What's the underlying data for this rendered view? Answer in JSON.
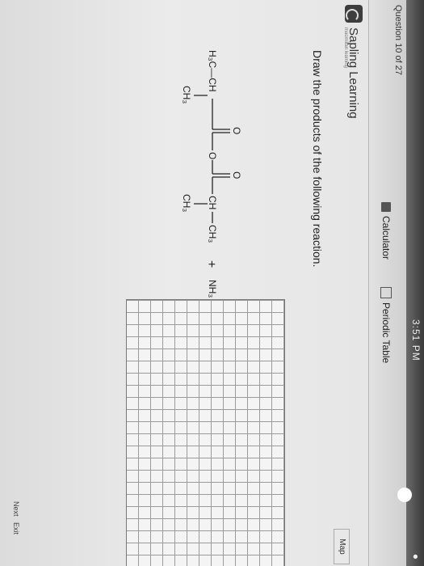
{
  "status_bar": {
    "clock": "3:51 PM"
  },
  "toolbar": {
    "question_counter": "Question 10 of 27",
    "calculator_label": "Calculator",
    "periodic_table_label": "Periodic Table"
  },
  "brand": {
    "name": "Sapling Learning",
    "tagline": "macmillan learning"
  },
  "map_button": "Map",
  "question": {
    "prompt": "Draw the products of the following reaction.",
    "reactant": {
      "left_group": "H₃C—CH",
      "left_methyl": "CH₃",
      "carbonyl_o1": "O",
      "ester_o": "O",
      "carbonyl_o2": "O",
      "right_ch": "CH",
      "right_methyl_end": "CH₃",
      "right_methyl_below": "CH₃"
    },
    "plus": "+",
    "reagent": "NH₃",
    "arrow": "→"
  },
  "bottom": {
    "next": "Next",
    "exit": "Exit"
  }
}
